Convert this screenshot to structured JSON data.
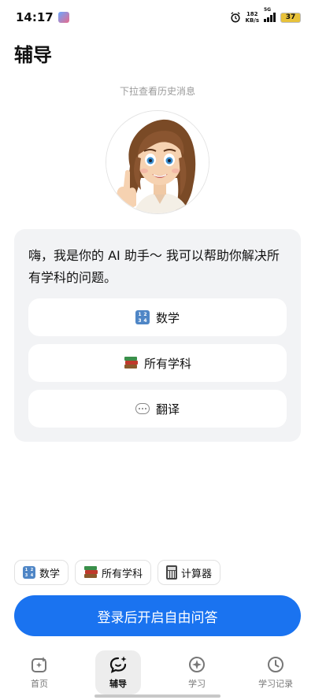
{
  "status_bar": {
    "time": "14:17",
    "net_speed_value": "182",
    "net_speed_unit": "KB/s",
    "network": "5G",
    "battery": "37"
  },
  "header": {
    "title": "辅导"
  },
  "history_hint": "下拉查看历史消息",
  "greeting": {
    "text": "嗨，我是你的 AI 助手～ 我可以帮助你解决所有学科的问题。",
    "options": [
      {
        "label": "数学",
        "icon": "numbers-icon"
      },
      {
        "label": "所有学科",
        "icon": "books-icon"
      },
      {
        "label": "翻译",
        "icon": "speech-bubble-icon"
      }
    ]
  },
  "quick_chips": [
    {
      "label": "数学",
      "icon": "numbers-icon"
    },
    {
      "label": "所有学科",
      "icon": "books-icon"
    },
    {
      "label": "计算器",
      "icon": "calculator-icon"
    }
  ],
  "cta": {
    "label": "登录后开启自由问答"
  },
  "tabs": [
    {
      "label": "首页",
      "icon": "home-sparkle-icon",
      "active": false
    },
    {
      "label": "辅导",
      "icon": "chat-sparkle-icon",
      "active": true
    },
    {
      "label": "学习",
      "icon": "compass-icon",
      "active": false
    },
    {
      "label": "学习记录",
      "icon": "clock-icon",
      "active": false
    }
  ],
  "colors": {
    "accent": "#1a73f0",
    "card_bg": "#f2f3f5",
    "hint_text": "#9a9a9a"
  }
}
